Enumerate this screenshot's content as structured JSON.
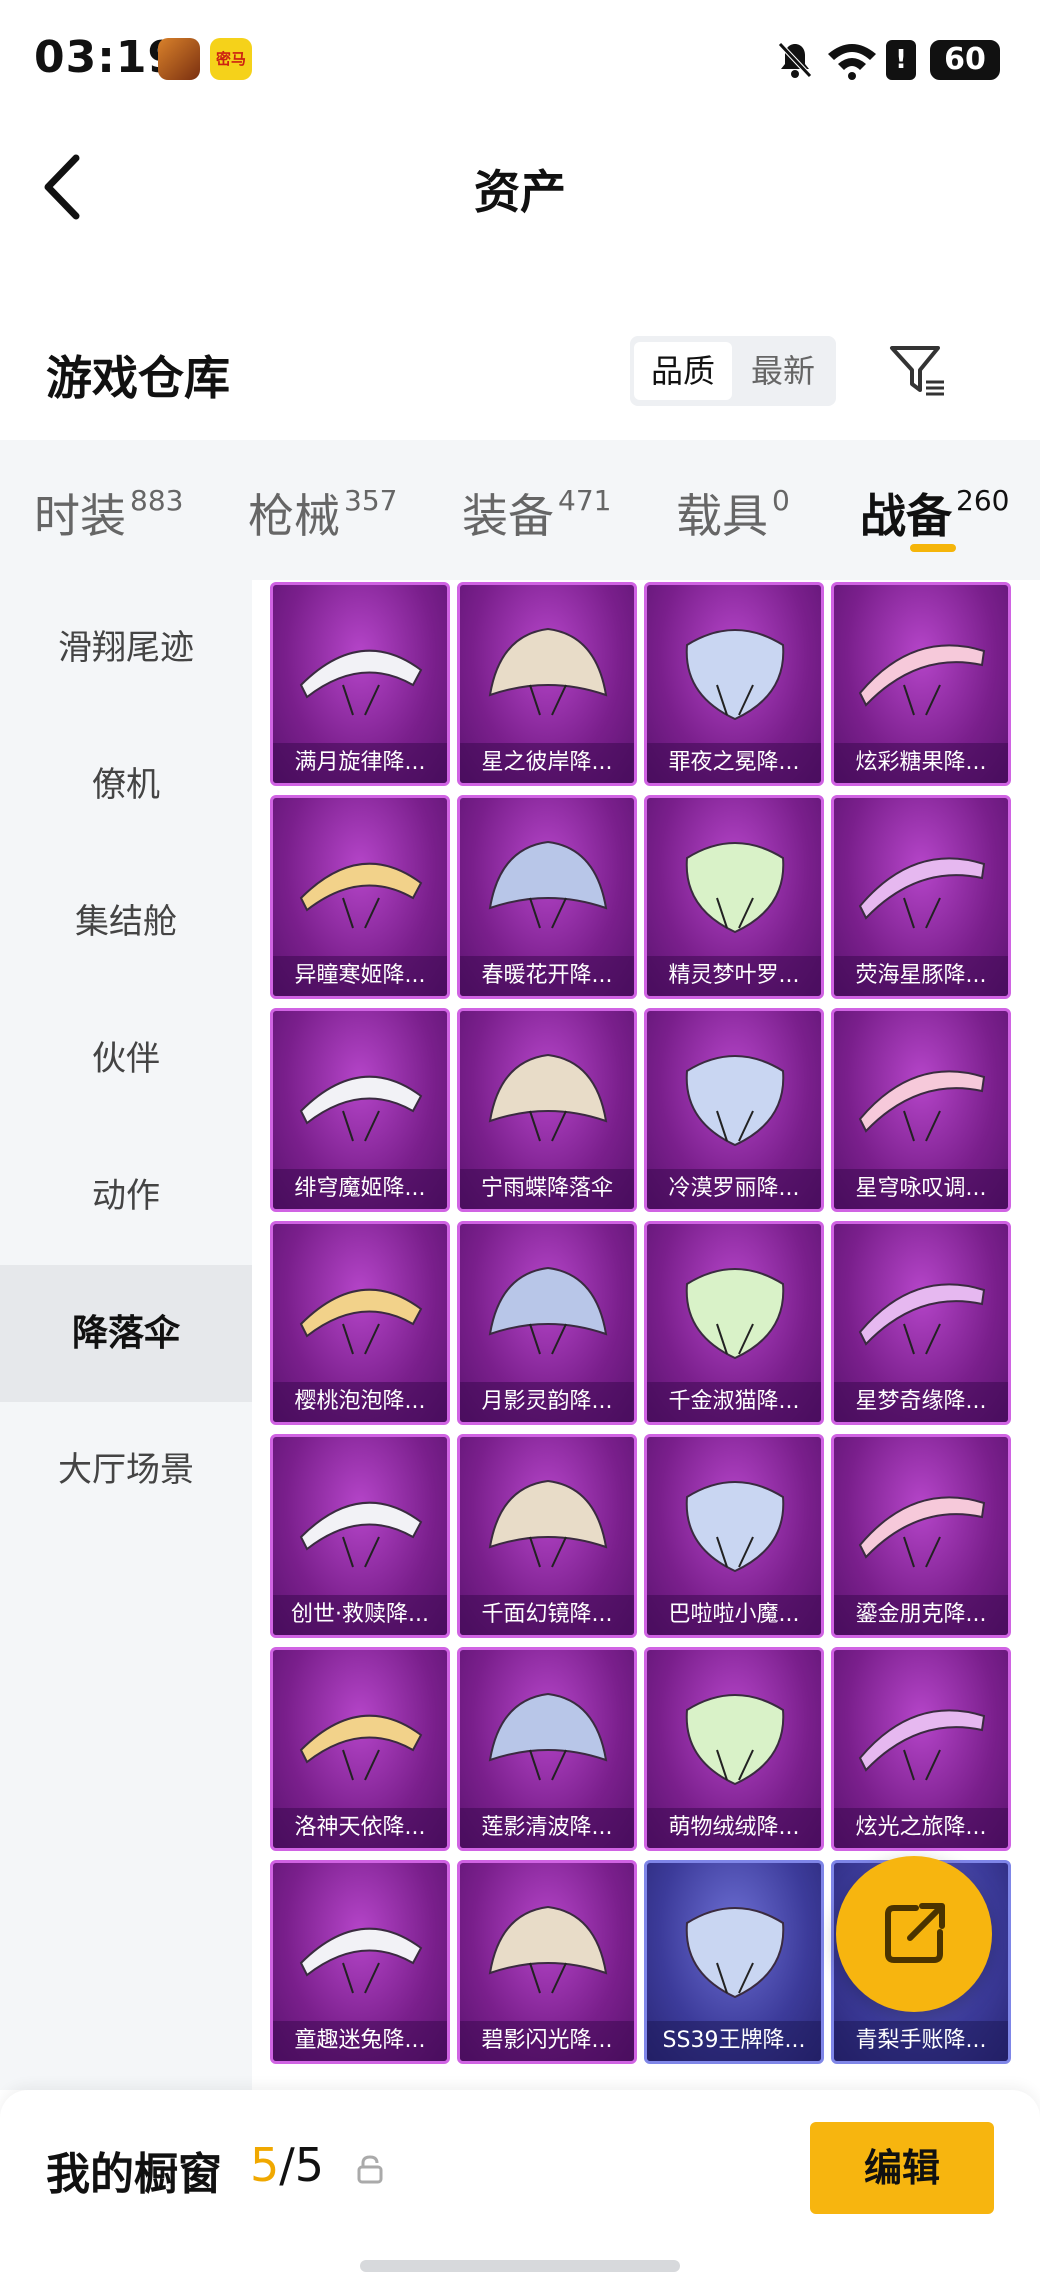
{
  "status_bar": {
    "time": "03:19",
    "app_badge": "密马",
    "battery": "60"
  },
  "header": {
    "title": "资产"
  },
  "warehouse": {
    "title": "游戏仓库",
    "sort_active": "品质",
    "sort_other": "最新"
  },
  "tabs": [
    {
      "label": "时装",
      "count": "883"
    },
    {
      "label": "枪械",
      "count": "357"
    },
    {
      "label": "装备",
      "count": "471"
    },
    {
      "label": "载具",
      "count": "0"
    },
    {
      "label": "战备",
      "count": "260"
    }
  ],
  "sidebar": [
    {
      "label": "滑翔尾迹"
    },
    {
      "label": "僚机"
    },
    {
      "label": "集结舱"
    },
    {
      "label": "伙伴"
    },
    {
      "label": "动作"
    },
    {
      "label": "降落伞"
    },
    {
      "label": "大厅场景"
    }
  ],
  "items": [
    "满月旋律降...",
    "星之彼岸降...",
    "罪夜之冕降...",
    "炫彩糖果降...",
    "异瞳寒姬降...",
    "春暖花开降...",
    "精灵梦叶罗...",
    "荧海星豚降...",
    "绯穹魔姬降...",
    "宁雨蝶降落伞",
    "冷漠罗丽降...",
    "星穹咏叹调...",
    "樱桃泡泡降...",
    "月影灵韵降...",
    "千金淑猫降...",
    "星梦奇缘降...",
    "创世·救赎降...",
    "千面幻镜降...",
    "巴啦啦小魔...",
    "鎏金朋克降...",
    "洛神天依降...",
    "莲影清波降...",
    "萌物绒绒降...",
    "炫光之旅降...",
    "童趣迷兔降...",
    "碧影闪光降...",
    "SS39王牌降...",
    "青梨手账降..."
  ],
  "bottom": {
    "title": "我的橱窗",
    "count_current": "5",
    "count_sep": "/",
    "count_total": "5",
    "edit_label": "编辑"
  },
  "colors": {
    "accent": "#f7b50f",
    "card_purple": "#7a1f8c",
    "card_blue": "#3c3b9a"
  }
}
